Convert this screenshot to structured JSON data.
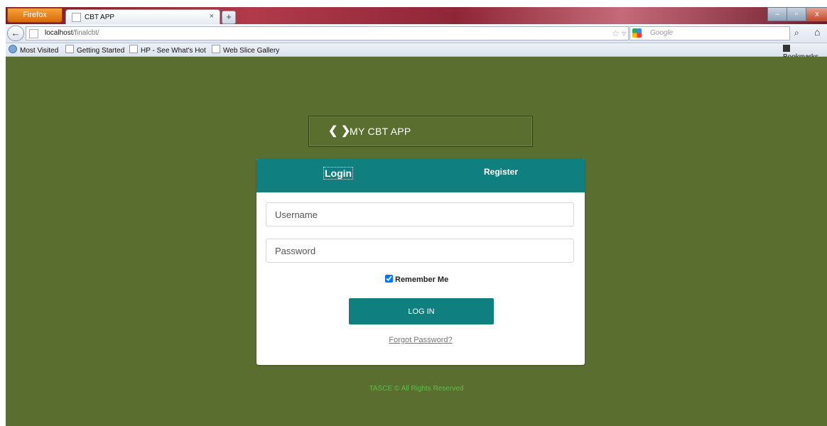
{
  "browser": {
    "app_button": "Firefox",
    "tab": {
      "title": "CBT APP",
      "close": "×"
    },
    "new_tab": "+",
    "window_controls": {
      "minimize": "–",
      "maximize": "▫",
      "close": "x"
    },
    "nav": {
      "back": "←",
      "url_host": "localhost",
      "url_path": "/finalcbt/",
      "star": "☆ ▿",
      "reload": "C",
      "search_engine": "Google",
      "search_go": "⌕",
      "home": "⌂"
    },
    "bookmarks": [
      {
        "label": "Most Visited",
        "icon": "globe-icon"
      },
      {
        "label": "Getting Started",
        "icon": "page-icon"
      },
      {
        "label": "HP - See What's Hot",
        "icon": "page-icon"
      },
      {
        "label": "Web Slice Gallery",
        "icon": "page-icon"
      }
    ],
    "bookmarks_menu": "Bookmarks"
  },
  "page": {
    "brand_icon": "❮ ❯",
    "brand_text": "MY CBT APP",
    "tabs": {
      "login": "Login",
      "register": "Register"
    },
    "form": {
      "username_placeholder": "Username",
      "password_placeholder": "Password",
      "remember_label": "Remember Me",
      "remember_checked": true,
      "submit_label": "LOG IN",
      "forgot_label": "Forgot Password?"
    },
    "footer": "TASCE © All Rights Reserved"
  },
  "colors": {
    "page_bg": "#5a6e30",
    "accent_teal": "#0f7f80",
    "footer_text": "#5cbf4a"
  }
}
